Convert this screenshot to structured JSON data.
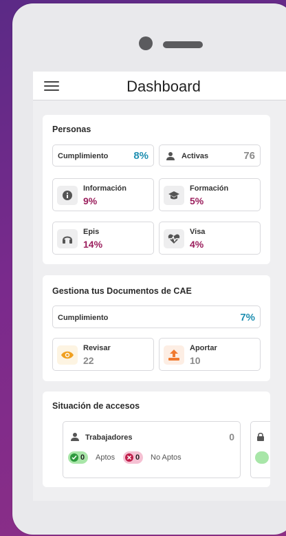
{
  "header": {
    "title": "Dashboard"
  },
  "personas": {
    "title": "Personas",
    "cumplimiento": {
      "label": "Cumplimiento",
      "value": "8%"
    },
    "activas": {
      "label": "Activas",
      "value": "76"
    },
    "tiles": [
      {
        "label": "Información",
        "value": "9%",
        "icon": "info-icon"
      },
      {
        "label": "Formación",
        "value": "5%",
        "icon": "graduation-cap-icon"
      },
      {
        "label": "Epis",
        "value": "14%",
        "icon": "headphones-icon"
      },
      {
        "label": "Visa",
        "value": "4%",
        "icon": "heart-pulse-icon"
      }
    ]
  },
  "documentos": {
    "title": "Gestiona tus Documentos de CAE",
    "cumplimiento": {
      "label": "Cumplimiento",
      "value": "7%"
    },
    "revisar": {
      "label": "Revisar",
      "value": "22",
      "icon": "eye-icon"
    },
    "aportar": {
      "label": "Aportar",
      "value": "10",
      "icon": "upload-icon"
    }
  },
  "accesos": {
    "title": "Situación de accesos",
    "trabajadores": {
      "label": "Trabajadores",
      "count": "0",
      "aptos_count": "0",
      "aptos_label": "Aptos",
      "no_aptos_count": "0",
      "no_aptos_label": "No Aptos"
    }
  },
  "colors": {
    "teal": "#1f8fb1",
    "magenta": "#9b1f5d",
    "apto_green": "#7fd27f",
    "no_apto_pink": "#f5b5cb",
    "revisar_orange": "#f0a020",
    "aportar_orange": "#f07a30"
  }
}
